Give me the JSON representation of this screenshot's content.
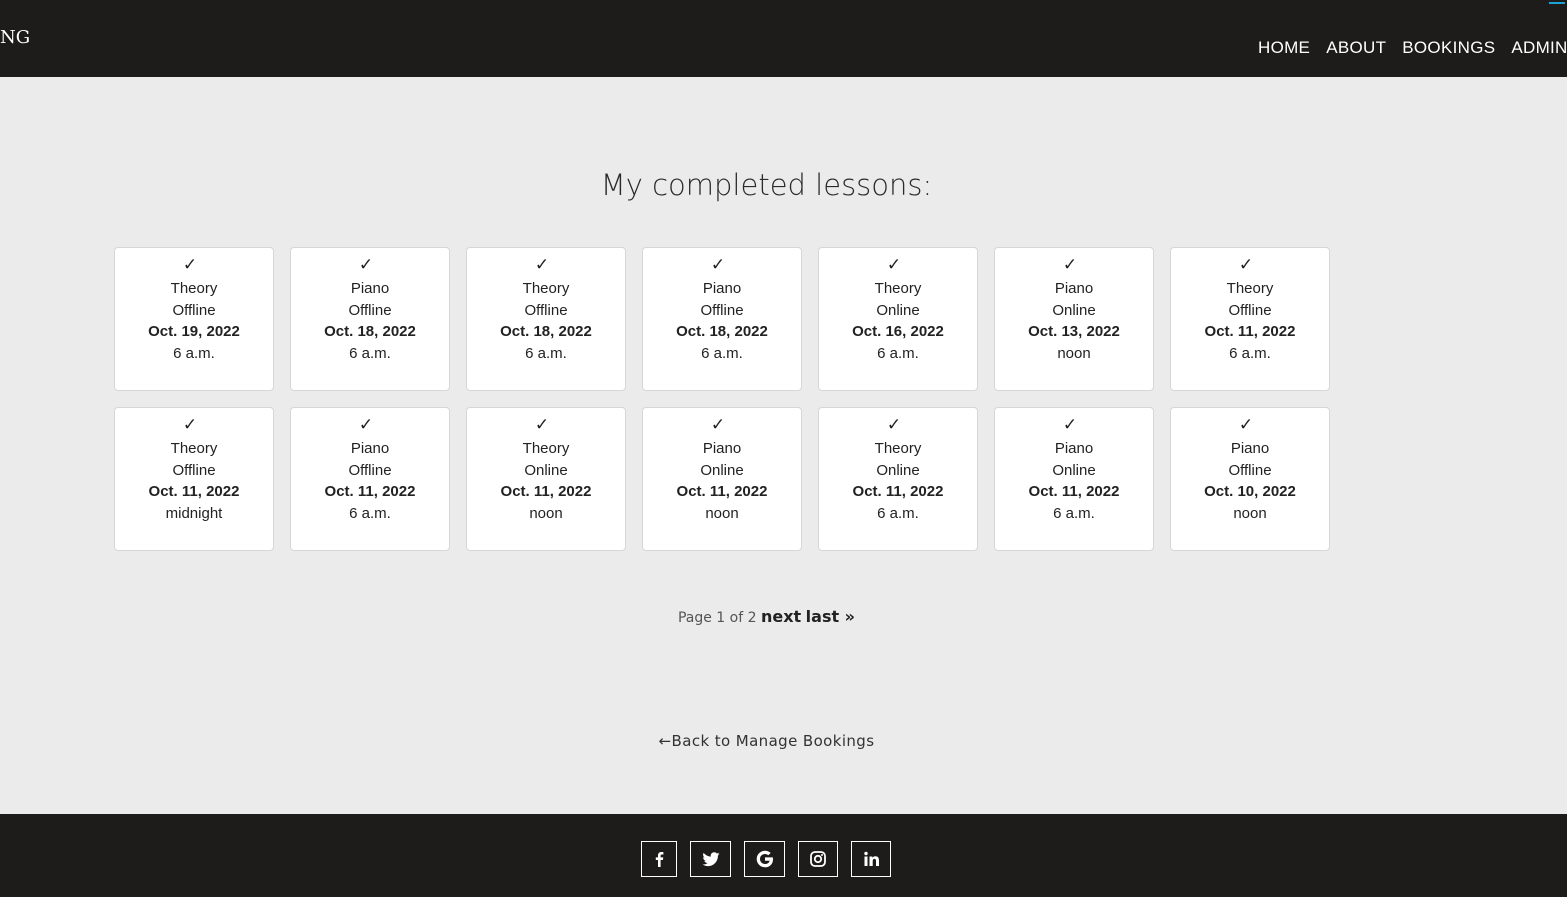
{
  "header": {
    "brand": "NG",
    "nav": [
      {
        "label": "HOME"
      },
      {
        "label": "ABOUT"
      },
      {
        "label": "BOOKINGS"
      },
      {
        "label": "ADMIN"
      }
    ]
  },
  "main": {
    "title": "My completed lessons:",
    "lessons": [
      {
        "subject": "Theory",
        "mode": "Offline",
        "date": "Oct. 19, 2022",
        "time": "6 a.m."
      },
      {
        "subject": "Piano",
        "mode": "Offline",
        "date": "Oct. 18, 2022",
        "time": "6 a.m."
      },
      {
        "subject": "Theory",
        "mode": "Offline",
        "date": "Oct. 18, 2022",
        "time": "6 a.m."
      },
      {
        "subject": "Piano",
        "mode": "Offline",
        "date": "Oct. 18, 2022",
        "time": "6 a.m."
      },
      {
        "subject": "Theory",
        "mode": "Online",
        "date": "Oct. 16, 2022",
        "time": "6 a.m."
      },
      {
        "subject": "Piano",
        "mode": "Online",
        "date": "Oct. 13, 2022",
        "time": "noon"
      },
      {
        "subject": "Theory",
        "mode": "Offline",
        "date": "Oct. 11, 2022",
        "time": "6 a.m."
      },
      {
        "subject": "Theory",
        "mode": "Offline",
        "date": "Oct. 11, 2022",
        "time": "midnight"
      },
      {
        "subject": "Piano",
        "mode": "Offline",
        "date": "Oct. 11, 2022",
        "time": "6 a.m."
      },
      {
        "subject": "Theory",
        "mode": "Online",
        "date": "Oct. 11, 2022",
        "time": "noon"
      },
      {
        "subject": "Piano",
        "mode": "Online",
        "date": "Oct. 11, 2022",
        "time": "noon"
      },
      {
        "subject": "Theory",
        "mode": "Online",
        "date": "Oct. 11, 2022",
        "time": "6 a.m."
      },
      {
        "subject": "Piano",
        "mode": "Online",
        "date": "Oct. 11, 2022",
        "time": "6 a.m."
      },
      {
        "subject": "Piano",
        "mode": "Offline",
        "date": "Oct. 10, 2022",
        "time": "noon"
      }
    ],
    "check_icon": "checkmark-icon",
    "check_glyph": "✓",
    "pagination": {
      "status": "Page 1 of 2",
      "next_label": "next",
      "last_label": "last »"
    },
    "back_link": {
      "icon": "arrow-left-icon",
      "arrow": "←",
      "label": "Back to Manage Bookings"
    }
  },
  "footer": {
    "social": [
      {
        "name": "facebook",
        "icon": "facebook-icon"
      },
      {
        "name": "twitter",
        "icon": "twitter-icon"
      },
      {
        "name": "google",
        "icon": "google-icon"
      },
      {
        "name": "instagram",
        "icon": "instagram-icon"
      },
      {
        "name": "linkedin",
        "icon": "linkedin-icon"
      }
    ]
  },
  "colors": {
    "header_bg": "#1d1c1b",
    "page_bg": "#ebebeb",
    "card_bg": "#ffffff",
    "footer_bg": "#1d1c1b",
    "accent": "#1aa3d6"
  }
}
